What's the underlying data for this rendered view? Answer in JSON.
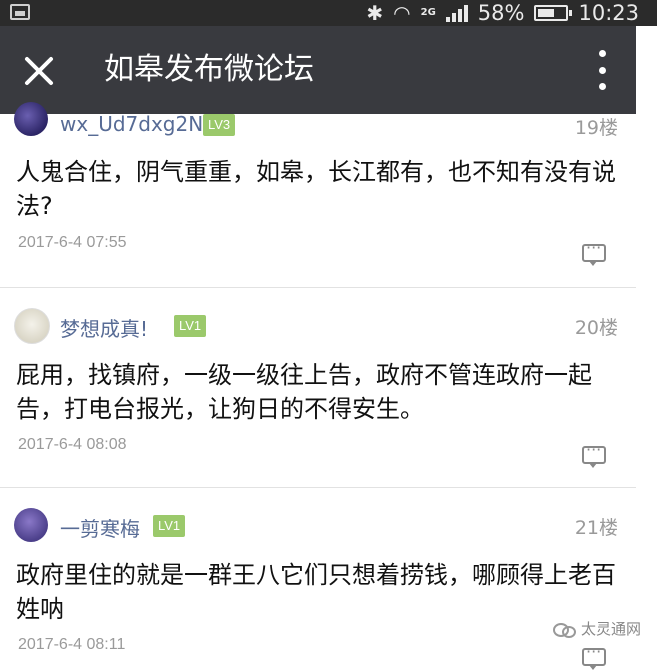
{
  "status_bar": {
    "network": "2G",
    "battery": "58%",
    "battery_level": 0.58,
    "time": "10:23"
  },
  "app_bar": {
    "title": "如皋发布微论坛"
  },
  "posts": [
    {
      "username": "wx_Ud7dxg2N",
      "level": "LV3",
      "floor": "19楼",
      "content": "人鬼合住，阴气重重，如皋，长江都有，也不知有没有说法?",
      "time": "2017-6-4 07:55"
    },
    {
      "username": "梦想成真!",
      "level": "LV1",
      "floor": "20楼",
      "content": "屁用，找镇府，一级一级往上告，政府不管连政府一起告，打电台报光，让狗日的不得安生。",
      "time": "2017-6-4 08:08"
    },
    {
      "username": "一剪寒梅",
      "level": "LV1",
      "floor": "21楼",
      "content": "政府里住的就是一群王八它们只想着捞钱，哪顾得上老百姓呐",
      "time": "2017-6-4 08:11"
    }
  ],
  "watermark": "太灵通网",
  "colors": {
    "status_bar_bg": "#2b2b2b",
    "app_bar_bg": "#393a3f",
    "username": "#576b95",
    "level_badge": "#9bc96b"
  }
}
